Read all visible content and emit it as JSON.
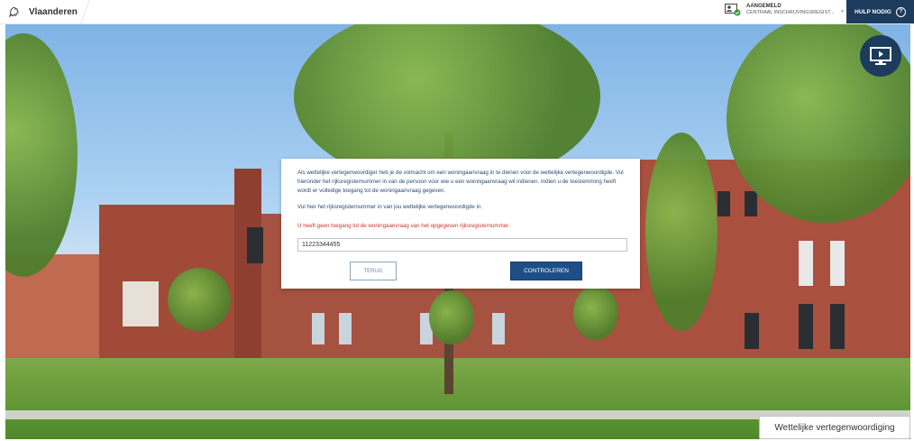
{
  "header": {
    "brand": "Vlaanderen",
    "user_status": "AANGEMELD",
    "user_org": "CENTRAAL INSCHRIJVINGSREGIST...",
    "chevron": "⌄",
    "help_label": "HULP NODIG",
    "help_icon": "?"
  },
  "dialog": {
    "intro": "Als wettelijke vertegenwoordiger heb je de volmacht om een woningaanvraag in te dienen voor de wettelijke vertegenwoordigde. Vul hieronder het rijksregisternummer in van de persoon voor wie u een woningaanvraag wil indienen. Indien u de toestemming heeft wordt er volledige toegang tot de woningaanvraag gegeven.",
    "instruction": "Vul hier het rijksregisternummer in van jou wettelijke vertegenwoordigde in.",
    "error": "U heeft geen toegang tot de woningaanvraag van het opgegeven rijksregisternummer.",
    "input_value": "11223344455",
    "back_label": "TERUG",
    "check_label": "CONTROLEREN"
  },
  "footer_badge": "Wettelijke vertegenwoordiging",
  "colors": {
    "primary": "#1d4f86",
    "navy": "#1d3b5c",
    "error": "#d0342c",
    "text_blue": "#2c4a74"
  },
  "icons": {
    "logo": "flemish-lion-icon",
    "user": "user-check-icon",
    "help": "question-icon",
    "tv": "screen-play-icon"
  }
}
